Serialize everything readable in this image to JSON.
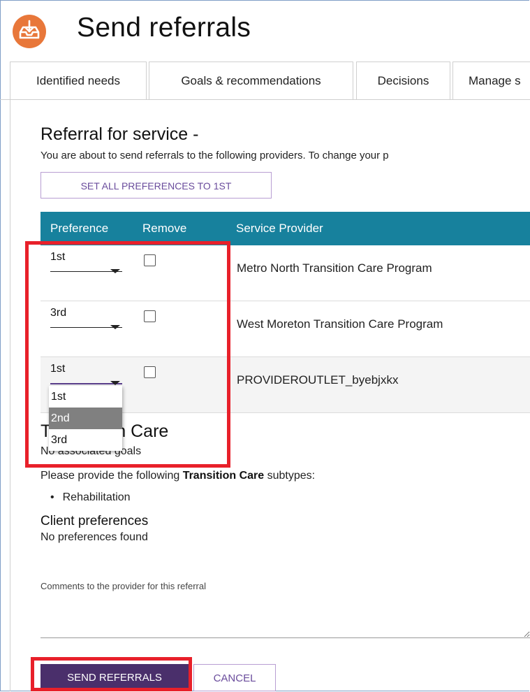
{
  "header": {
    "title": "Send referrals",
    "logo_icon": "download-tray-icon",
    "logo_color": "#e8773a"
  },
  "tabs": [
    {
      "label": "Identified needs"
    },
    {
      "label": "Goals & recommendations"
    },
    {
      "label": "Decisions"
    },
    {
      "label": "Manage s"
    }
  ],
  "referral": {
    "title": "Referral for service -",
    "instruction": "You are about to send referrals to the following providers. To change your p",
    "set_all_button": "SET ALL PREFERENCES TO 1ST"
  },
  "table": {
    "headers": {
      "preference": "Preference",
      "remove": "Remove",
      "provider": "Service Provider"
    },
    "header_color": "#17819d",
    "rows": [
      {
        "preference": "1st",
        "remove": false,
        "provider": "Metro North Transition Care Program"
      },
      {
        "preference": "3rd",
        "remove": false,
        "provider": "West Moreton Transition Care Program"
      },
      {
        "preference": "1st",
        "remove": false,
        "provider": "PROVIDEROUTLET_byebjxkx"
      }
    ]
  },
  "dropdown": {
    "options": [
      "1st",
      "2nd",
      "3rd"
    ],
    "highlighted": "2nd"
  },
  "transition_care": {
    "title": "Transition Care",
    "visible_title_start": "T",
    "visible_title_end": "n Care",
    "goals": "No associated goals",
    "goals_visible": "No associated goals",
    "subtypes_prefix": "Please provide the following ",
    "subtypes_bold": "Transition Care",
    "subtypes_suffix": " subtypes:",
    "subtypes": [
      "Rehabilitation"
    ],
    "client_pref_title": "Client preferences",
    "client_pref_text": "No preferences found"
  },
  "comments": {
    "label": "Comments to the provider for this referral",
    "value": ""
  },
  "actions": {
    "send": "SEND REFERRALS",
    "cancel": "CANCEL",
    "send_color": "#4a2f6b"
  },
  "highlight_color": "#e8202a"
}
